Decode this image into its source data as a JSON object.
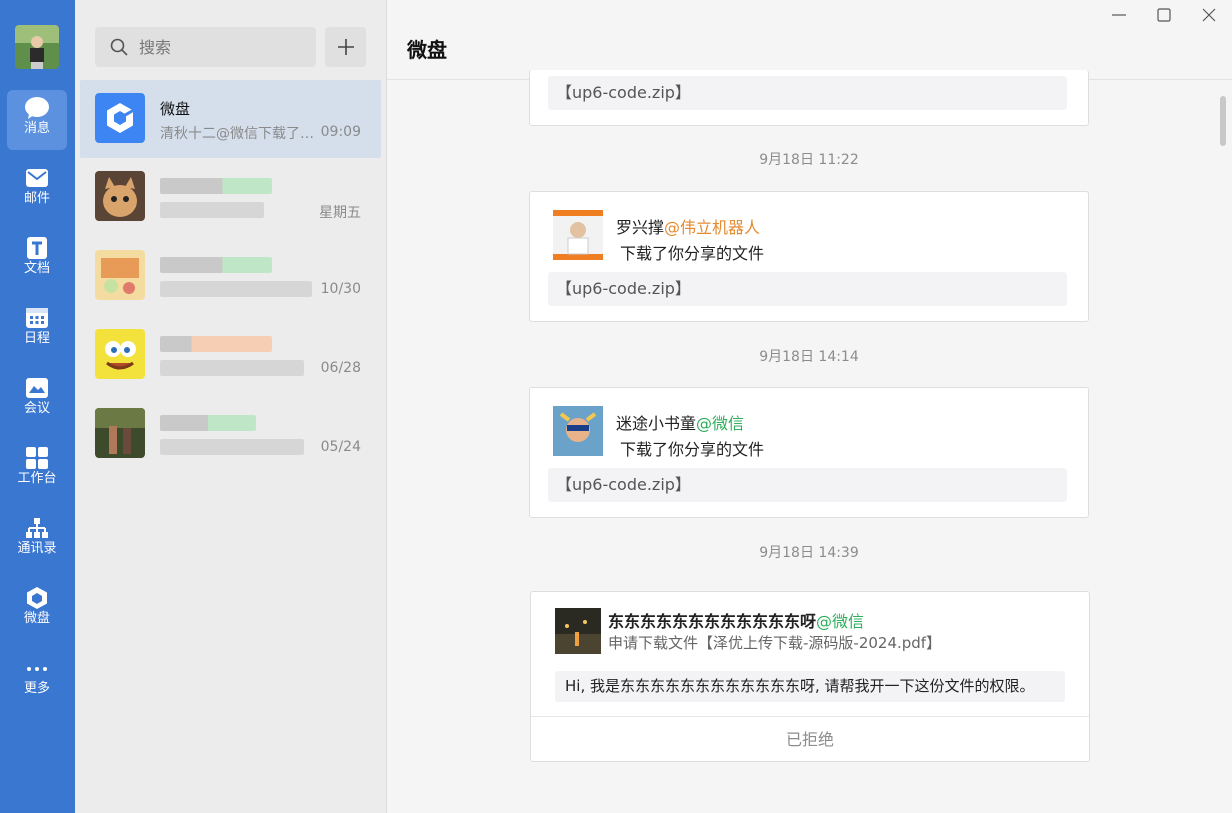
{
  "rail": {
    "items": [
      {
        "label": "消息"
      },
      {
        "label": "邮件"
      },
      {
        "label": "文档"
      },
      {
        "label": "日程"
      },
      {
        "label": "会议"
      },
      {
        "label": "工作台"
      },
      {
        "label": "通讯录"
      },
      {
        "label": "微盘"
      },
      {
        "label": "更多"
      }
    ]
  },
  "search": {
    "placeholder": "搜索"
  },
  "conversations": [
    {
      "name": "微盘",
      "preview": "清秋十二@微信下载了你分享的文件",
      "time": "09:09"
    },
    {
      "time": "星期五"
    },
    {
      "time": "10/30"
    },
    {
      "time": "06/28"
    },
    {
      "time": "05/24"
    }
  ],
  "main": {
    "title": "微盘",
    "first_file": "【up6-code.zip】",
    "messages": [
      {
        "time": "9月18日 11:22",
        "user": "罗兴撑",
        "org": "@伟立机器人",
        "action": "下载了你分享的文件",
        "file": "【up6-code.zip】"
      },
      {
        "time": "9月18日 14:14",
        "user": "迷途小书童",
        "org": "@微信",
        "action": "下载了你分享的文件",
        "file": "【up6-code.zip】"
      }
    ],
    "request": {
      "time": "9月18日 14:39",
      "user": "东东东东东东东东东东东东呀",
      "org": "@微信",
      "subtitle": "申请下载文件【泽优上传下载-源码版-2024.pdf】",
      "message": "Hi, 我是东东东东东东东东东东东东呀, 请帮我开一下这份文件的权限。",
      "status": "已拒绝"
    }
  },
  "colors": {
    "rail": "#3a77d1",
    "org": "#e58a2f",
    "wechat": "#2fae5c"
  }
}
